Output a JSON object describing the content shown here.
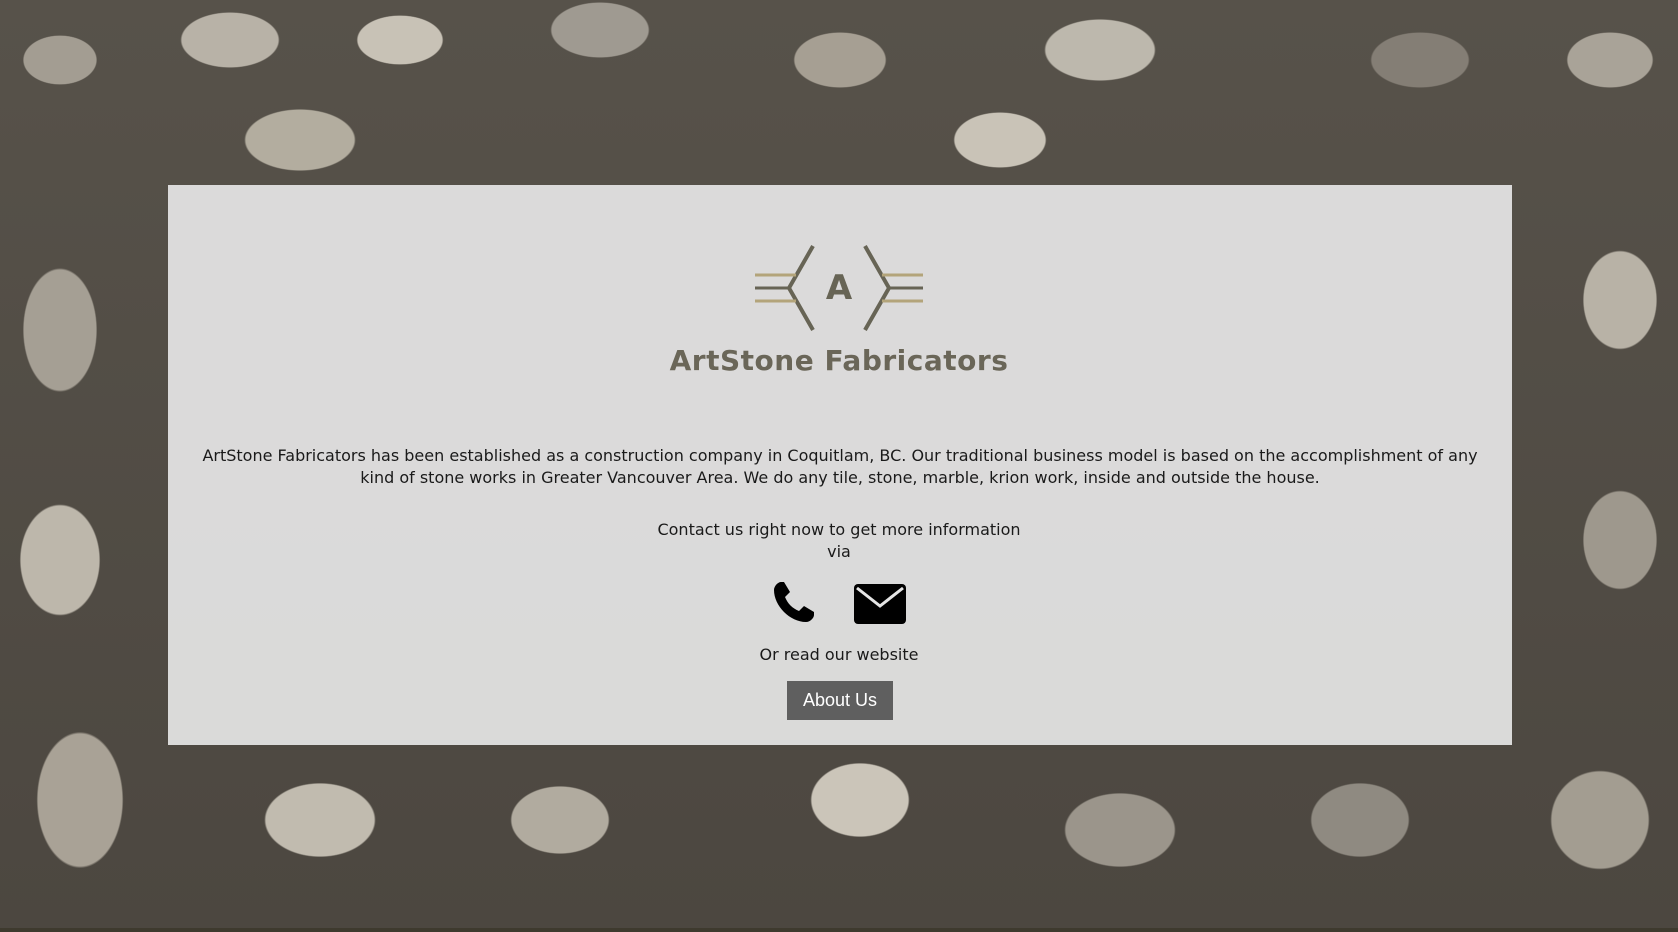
{
  "brand": {
    "name": "ArtStone Fabricators",
    "logo_letter": "A"
  },
  "main": {
    "description": "ArtStone Fabricators has been established as a construction company in Coquitlam, BC. Our traditional business model is based on the accomplishment of any kind of stone works in Greater Vancouver Area. We do any tile, stone, marble, krion work, inside and outside the house.",
    "contact_line1": "Contact us right now to get more information",
    "contact_line2": "via",
    "icons": [
      "phone-icon",
      "envelope-icon"
    ],
    "read_text": "Or read our website",
    "about_button": "About Us"
  },
  "colors": {
    "brand_text": "#6a6658",
    "logo_gold": "#b3a47a",
    "logo_dark": "#676455",
    "button_bg": "#5f5f5f",
    "panel_bg": "#e5e5e5"
  }
}
